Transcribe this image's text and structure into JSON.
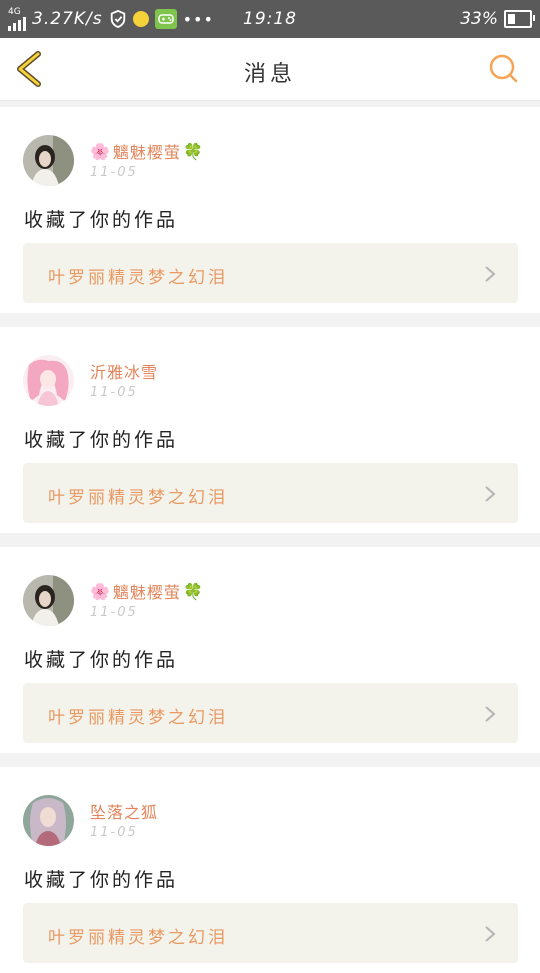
{
  "status_bar": {
    "network_type": "4G",
    "speed": "3.27K/s",
    "more": "•••",
    "time": "19:18",
    "battery_pct": "33%",
    "battery_level": 0.33
  },
  "header": {
    "title": "消息",
    "accent_color": "#f7a356"
  },
  "notifications": [
    {
      "username": "魑魅樱萤",
      "username_prefix_icon": "flower-icon",
      "username_suffix_icon": "clover-icon",
      "date": "11-05",
      "action": "收藏了你的作品",
      "work_title": "叶罗丽精灵梦之幻泪",
      "avatar": "girl-photo-avatar"
    },
    {
      "username": "沂雅冰雪",
      "username_prefix_icon": "",
      "username_suffix_icon": "",
      "date": "11-05",
      "action": "收藏了你的作品",
      "work_title": "叶罗丽精灵梦之幻泪",
      "avatar": "pink-anime-avatar"
    },
    {
      "username": "魑魅樱萤",
      "username_prefix_icon": "flower-icon",
      "username_suffix_icon": "clover-icon",
      "date": "11-05",
      "action": "收藏了你的作品",
      "work_title": "叶罗丽精灵梦之幻泪",
      "avatar": "girl-photo-avatar"
    },
    {
      "username": "坠落之狐",
      "username_prefix_icon": "",
      "username_suffix_icon": "",
      "date": "11-05",
      "action": "收藏了你的作品",
      "work_title": "叶罗丽精灵梦之幻泪",
      "avatar": "anime-girl-avatar"
    }
  ]
}
